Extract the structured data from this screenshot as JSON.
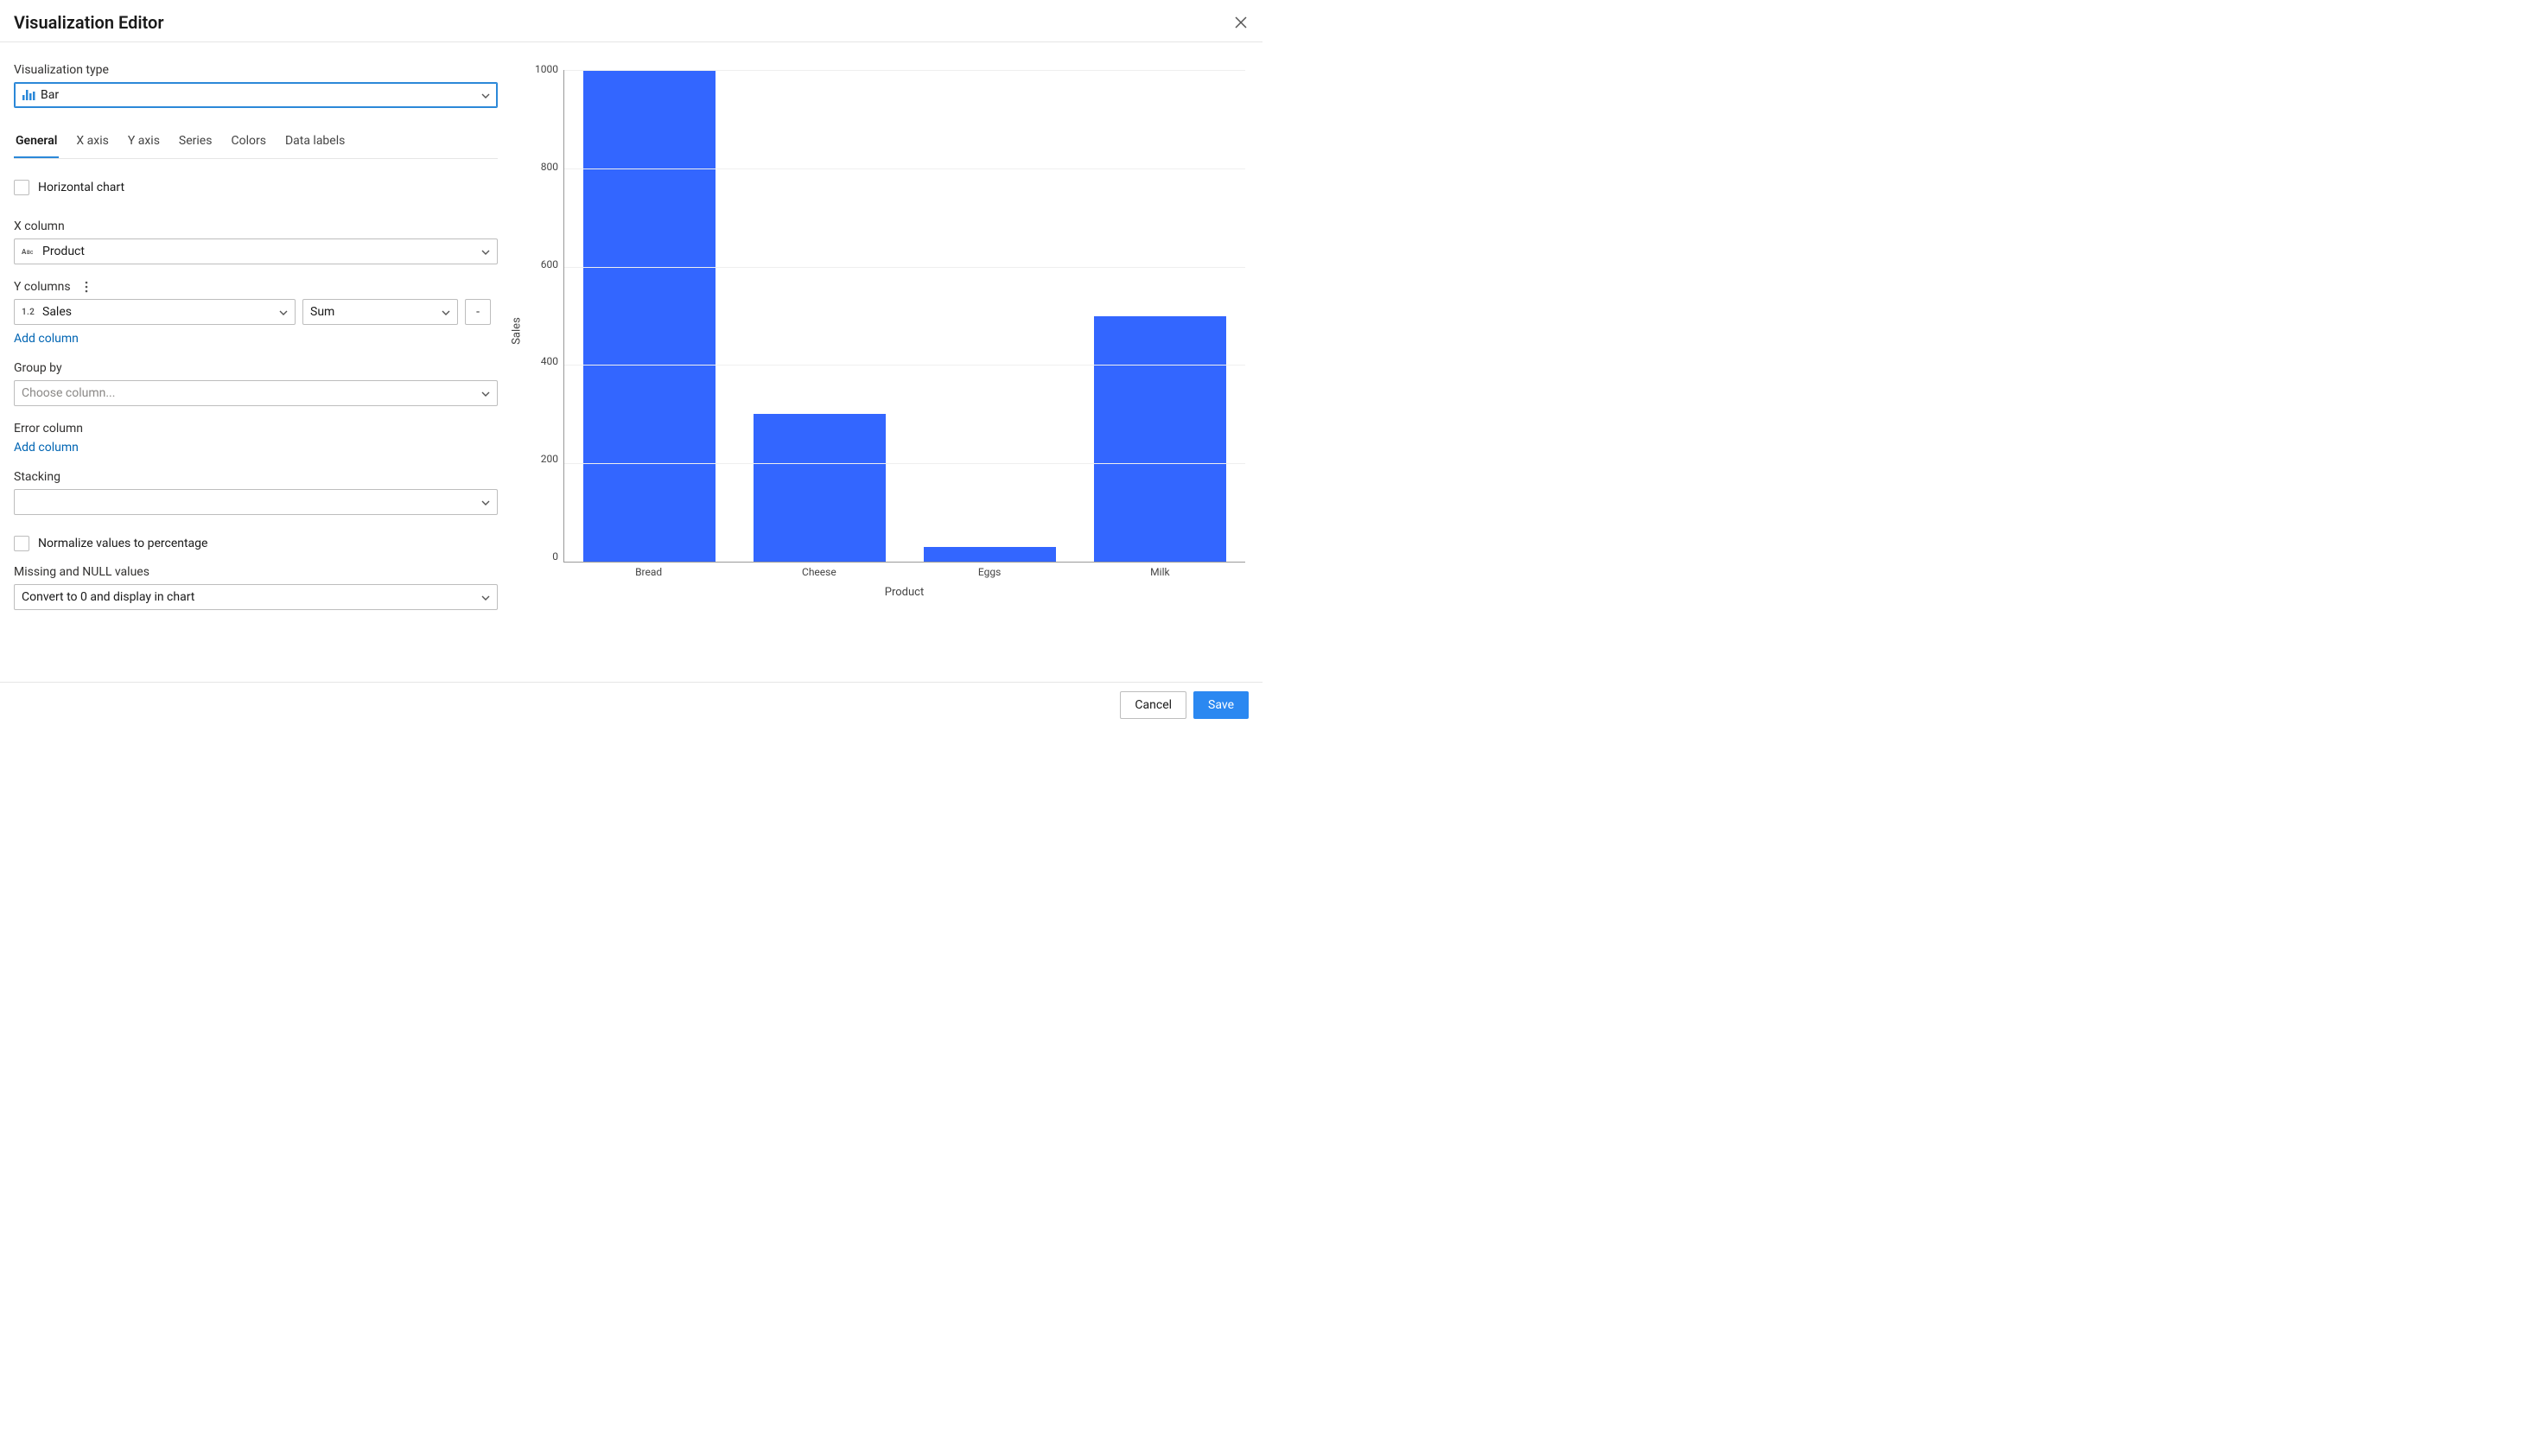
{
  "header": {
    "title": "Visualization Editor"
  },
  "viz_type": {
    "label": "Visualization type",
    "value": "Bar"
  },
  "tabs": [
    {
      "label": "General",
      "active": true
    },
    {
      "label": "X axis",
      "active": false
    },
    {
      "label": "Y axis",
      "active": false
    },
    {
      "label": "Series",
      "active": false
    },
    {
      "label": "Colors",
      "active": false
    },
    {
      "label": "Data labels",
      "active": false
    }
  ],
  "form": {
    "horizontal_chart_label": "Horizontal chart",
    "x_column_label": "X column",
    "x_column_value": "Product",
    "y_columns_label": "Y columns",
    "y_column_value": "Sales",
    "y_agg_value": "Sum",
    "remove_y_label": "-",
    "add_column_label": "Add column",
    "group_by_label": "Group by",
    "group_by_placeholder": "Choose column...",
    "error_column_label": "Error column",
    "add_error_column_label": "Add column",
    "stacking_label": "Stacking",
    "stacking_value": "",
    "normalize_label": "Normalize values to percentage",
    "missing_label": "Missing and NULL values",
    "missing_value": "Convert to 0 and display in chart"
  },
  "footer": {
    "cancel_label": "Cancel",
    "save_label": "Save"
  },
  "chart_data": {
    "type": "bar",
    "categories": [
      "Bread",
      "Cheese",
      "Eggs",
      "Milk"
    ],
    "values": [
      1000,
      300,
      30,
      500
    ],
    "xlabel": "Product",
    "ylabel": "Sales",
    "ylim": [
      0,
      1000
    ],
    "yticks": [
      0,
      200,
      400,
      600,
      800,
      1000
    ],
    "bar_color": "#3366ff"
  }
}
